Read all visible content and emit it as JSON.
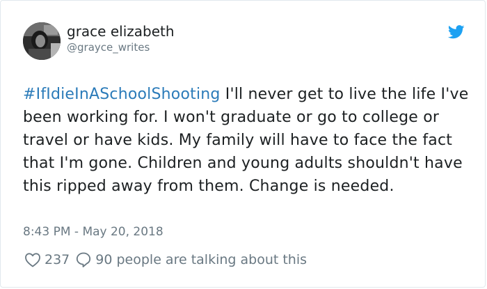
{
  "user": {
    "display_name": "grace elizabeth",
    "handle": "@grayce_writes"
  },
  "tweet": {
    "hashtag": "#IfIdieInASchoolShooting",
    "body": " I'll never get to live the life I've been working for. I won't graduate or go to college or travel or have kids. My family will have to face the fact that I'm gone. Children and young adults shouldn't have this ripped away from them. Change is needed.",
    "timestamp": "8:43 PM - May 20, 2018"
  },
  "actions": {
    "like_count": "237",
    "talking_text": "90 people are talking about this"
  },
  "icons": {
    "brand": "twitter-bird-icon",
    "like": "heart-icon",
    "reply": "speech-bubble-icon"
  },
  "colors": {
    "text": "#1c2022",
    "secondary": "#697882",
    "link": "#2b7bb9",
    "twitter_blue": "#1da1f2",
    "border": "#e1e8ed"
  }
}
